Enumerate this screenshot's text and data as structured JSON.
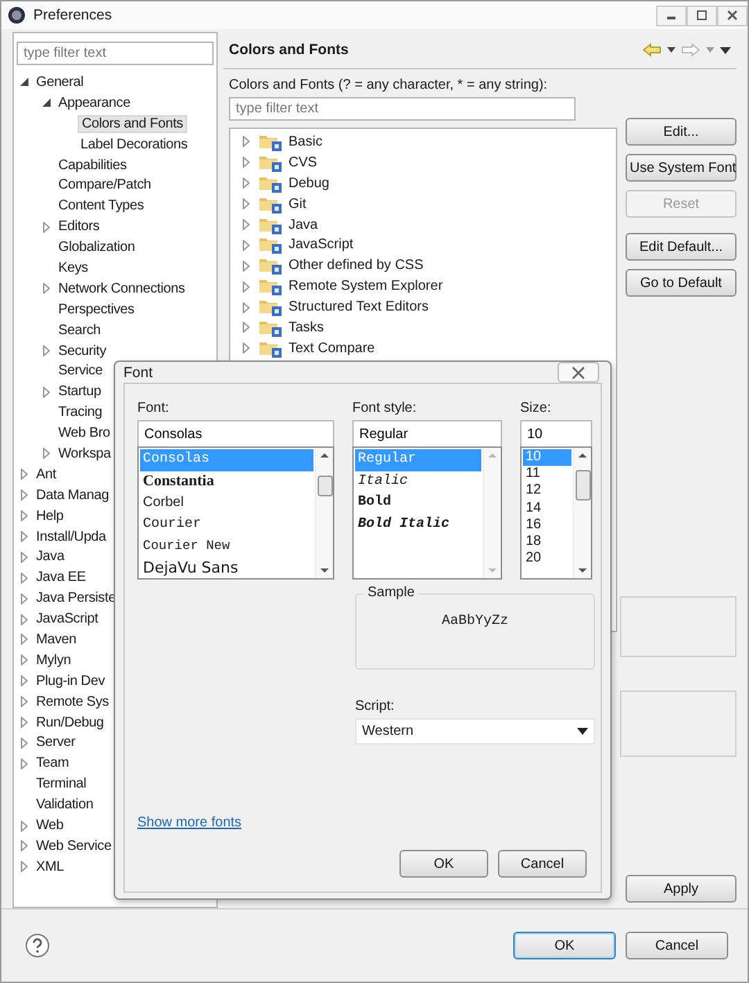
{
  "window": {
    "title": "Preferences"
  },
  "sidebar": {
    "search": {
      "placeholder": "type filter text"
    },
    "items": [
      {
        "label": "General",
        "kind": "branch",
        "expanded": true,
        "children": [
          {
            "label": "Appearance",
            "kind": "branch",
            "expanded": true,
            "children": [
              {
                "label": "Colors and Fonts",
                "kind": "leaf",
                "selected": true
              },
              {
                "label": "Label Decorations",
                "kind": "leaf",
                "selected": false
              }
            ]
          },
          {
            "label": "Capabilities",
            "kind": "leaf",
            "selected": false
          },
          {
            "label": "Compare/Patch",
            "kind": "leaf",
            "selected": false
          },
          {
            "label": "Content Types",
            "kind": "leaf",
            "selected": false
          },
          {
            "label": "Editors",
            "kind": "branch",
            "expanded": false
          },
          {
            "label": "Globalization",
            "kind": "leaf",
            "selected": false
          },
          {
            "label": "Keys",
            "kind": "leaf",
            "selected": false
          },
          {
            "label": "Network Connections",
            "kind": "branch",
            "expanded": false
          },
          {
            "label": "Perspectives",
            "kind": "leaf",
            "selected": false
          },
          {
            "label": "Search",
            "kind": "leaf",
            "selected": false
          },
          {
            "label": "Security",
            "kind": "branch",
            "expanded": false
          },
          {
            "label": "Service",
            "kind": "leaf",
            "selected": false
          },
          {
            "label": "Startup",
            "kind": "branch",
            "expanded": false
          },
          {
            "label": "Tracing",
            "kind": "leaf",
            "selected": false
          },
          {
            "label": "Web Bro",
            "kind": "leaf",
            "selected": false
          },
          {
            "label": "Workspa",
            "kind": "branch",
            "expanded": false
          }
        ]
      },
      {
        "label": "Ant",
        "kind": "branch",
        "expanded": false
      },
      {
        "label": "Data Manag",
        "kind": "branch",
        "expanded": false
      },
      {
        "label": "Help",
        "kind": "branch",
        "expanded": false
      },
      {
        "label": "Install/Upda",
        "kind": "branch",
        "expanded": false
      },
      {
        "label": "Java",
        "kind": "branch",
        "expanded": false
      },
      {
        "label": "Java EE",
        "kind": "branch",
        "expanded": false
      },
      {
        "label": "Java Persiste",
        "kind": "branch",
        "expanded": false
      },
      {
        "label": "JavaScript",
        "kind": "branch",
        "expanded": false
      },
      {
        "label": "Maven",
        "kind": "branch",
        "expanded": false
      },
      {
        "label": "Mylyn",
        "kind": "branch",
        "expanded": false
      },
      {
        "label": "Plug-in Dev",
        "kind": "branch",
        "expanded": false
      },
      {
        "label": "Remote Sys",
        "kind": "branch",
        "expanded": false
      },
      {
        "label": "Run/Debug",
        "kind": "branch",
        "expanded": false
      },
      {
        "label": "Server",
        "kind": "branch",
        "expanded": false
      },
      {
        "label": "Team",
        "kind": "branch",
        "expanded": false
      },
      {
        "label": "Terminal",
        "kind": "leaf",
        "selected": false
      },
      {
        "label": "Validation",
        "kind": "leaf",
        "selected": false
      },
      {
        "label": "Web",
        "kind": "branch",
        "expanded": false
      },
      {
        "label": "Web Service",
        "kind": "branch",
        "expanded": false
      },
      {
        "label": "XML",
        "kind": "branch",
        "expanded": false
      }
    ]
  },
  "page": {
    "title": "Colors and Fonts",
    "description": "Colors and Fonts (? = any character, * = any string):",
    "filter": {
      "placeholder": "type filter text"
    },
    "items": [
      {
        "label": "Basic",
        "expanded": false
      },
      {
        "label": "CVS",
        "expanded": false
      },
      {
        "label": "Debug",
        "expanded": false
      },
      {
        "label": "Git",
        "expanded": false
      },
      {
        "label": "Java",
        "expanded": false
      },
      {
        "label": "JavaScript",
        "expanded": false
      },
      {
        "label": "Other defined by CSS",
        "expanded": false
      },
      {
        "label": "Remote System Explorer",
        "expanded": false
      },
      {
        "label": "Structured Text Editors",
        "expanded": false
      },
      {
        "label": "Tasks",
        "expanded": false
      },
      {
        "label": "Text Compare",
        "expanded": false
      }
    ],
    "buttons": [
      {
        "label": "Edit...",
        "disabled": false
      },
      {
        "label": "Use System Font",
        "disabled": false
      },
      {
        "label": "Reset",
        "disabled": true
      },
      {
        "label": "Edit Default...",
        "disabled": false
      },
      {
        "label": "Go to Default",
        "disabled": false
      }
    ],
    "apply": "Apply"
  },
  "footer": {
    "buttons": [
      "OK",
      "Cancel"
    ]
  },
  "font_dialog": {
    "title": "Font",
    "font": {
      "label": "Font:",
      "value": "Consolas",
      "options": [
        {
          "label": "Consolas",
          "kind": "mono",
          "selected": true
        },
        {
          "label": "Constantia",
          "kind": "serif-bold",
          "selected": false
        },
        {
          "label": "Corbel",
          "kind": "sans",
          "selected": false
        },
        {
          "label": "Courier",
          "kind": "mono",
          "selected": false
        },
        {
          "label": "Courier New",
          "kind": "mono-small",
          "selected": false
        },
        {
          "label": "DejaVu Sans",
          "kind": "sans-large",
          "selected": false
        }
      ]
    },
    "style": {
      "label": "Font style:",
      "value": "Regular",
      "options": [
        {
          "label": "Regular",
          "kind": "regular",
          "selected": true
        },
        {
          "label": "Italic",
          "kind": "italic",
          "selected": false
        },
        {
          "label": "Bold",
          "kind": "bold",
          "selected": false
        },
        {
          "label": "Bold Italic",
          "kind": "bold-italic",
          "selected": false
        }
      ]
    },
    "size": {
      "label": "Size:",
      "value": "10",
      "options": [
        {
          "label": "10",
          "selected": true
        },
        {
          "label": "11",
          "selected": false
        },
        {
          "label": "12",
          "selected": false
        },
        {
          "label": "14",
          "selected": false
        },
        {
          "label": "16",
          "selected": false
        },
        {
          "label": "18",
          "selected": false
        },
        {
          "label": "20",
          "selected": false
        }
      ]
    },
    "sample": {
      "label": "Sample",
      "text": "AaBbYyZz"
    },
    "script": {
      "label": "Script:",
      "value": "Western"
    },
    "link": "Show more fonts",
    "buttons": [
      "OK",
      "Cancel"
    ]
  }
}
